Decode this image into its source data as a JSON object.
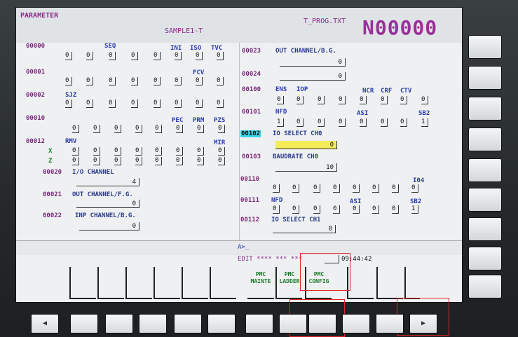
{
  "header": {
    "screen_title": "PARAMETER",
    "program_name": "SAMPLE1-T",
    "file_name": "T_PROG.TXT",
    "o_number": "N00000"
  },
  "left": {
    "p0000": {
      "number": "00000",
      "h_seq": "SEQ",
      "h_ini": "INI",
      "h_iso": "ISO",
      "h_tvc": "TVC"
    },
    "p0001": {
      "number": "00001",
      "h_fcv": "FCV"
    },
    "p0002": {
      "number": "00002",
      "h_sjz": "SJZ"
    },
    "p0010": {
      "number": "00010",
      "h_pec": "PEC",
      "h_prm": "PRM",
      "h_pzs": "PZS"
    },
    "p0012": {
      "number": "00012",
      "h_rmv": "RMV",
      "h_mir": "MIR",
      "axis_x": "X",
      "axis_z": "Z"
    },
    "p0020": {
      "number": "00020",
      "label": "I/O CHANNEL",
      "value": "4"
    },
    "p0021": {
      "number": "00021",
      "label": "OUT CHANNEL/F.G.",
      "value": "0"
    },
    "p0022": {
      "number": "00022",
      "label": "INP CHANNEL/B.G.",
      "value": "0"
    }
  },
  "right": {
    "p0023": {
      "number": "00023",
      "label": "OUT CHANNEL/B.G.",
      "value": "0"
    },
    "p0024": {
      "number": "00024",
      "value": "0"
    },
    "p0100": {
      "number": "00100",
      "h_ens": "ENS",
      "h_iop": "IOP",
      "h_ncr": "NCR",
      "h_crf": "CRF",
      "h_ctv": "CTV"
    },
    "p0101": {
      "number": "00101",
      "h_nfd": "NFD",
      "h_asi": "ASI",
      "h_sb2": "SB2"
    },
    "p0102": {
      "number": "00102",
      "label": "IO SELECT CH0",
      "value": "0"
    },
    "p0103": {
      "number": "00103",
      "label": "BAUDRATE CH0",
      "value": "10"
    },
    "p0110": {
      "number": "00110",
      "h_i04": "I04"
    },
    "p0111": {
      "number": "00111",
      "h_nfd": "NFD",
      "h_asi": "ASI",
      "h_sb2": "SB2"
    },
    "p0112": {
      "number": "00112",
      "label": "IO SELECT CH1",
      "value": "0"
    }
  },
  "bits": {
    "zero": "0",
    "one": "1"
  },
  "command": {
    "prompt": "A>_"
  },
  "status": {
    "mode": "EDIT **** *** ***",
    "time_h": "09",
    "time_m": "44",
    "time_s": "42"
  },
  "softkeys": [
    {
      "line1": "PMC",
      "line2": "MAINTE"
    },
    {
      "line1": "PMC",
      "line2": "LADDER"
    },
    {
      "line1": "PMC",
      "line2": "CONFIG"
    }
  ],
  "bottom_keys": {
    "prev": "◀",
    "next": "▶"
  },
  "colors": {
    "screen_bg": "#eef0f2",
    "highlight_field": "#f4ec5a",
    "cursor": "#3ad6e6",
    "header_blue": "#2a3ab0",
    "number_purple": "#7a2a7a",
    "annotation_red": "#e0242a"
  },
  "icons": {
    "prev": "left-arrow-icon",
    "next": "right-arrow-icon"
  }
}
